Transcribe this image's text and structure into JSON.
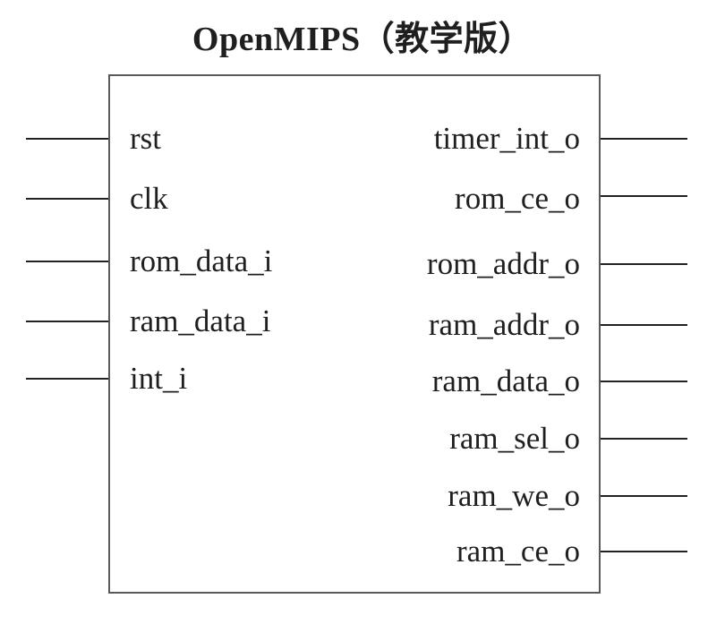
{
  "title": "OpenMIPS（教学版）",
  "inputs": [
    "rst",
    "clk",
    "rom_data_i",
    "ram_data_i",
    "int_i"
  ],
  "outputs": [
    "timer_int_o",
    "rom_ce_o",
    "rom_addr_o",
    "ram_addr_o",
    "ram_data_o",
    "ram_sel_o",
    "ram_we_o",
    "ram_ce_o"
  ]
}
